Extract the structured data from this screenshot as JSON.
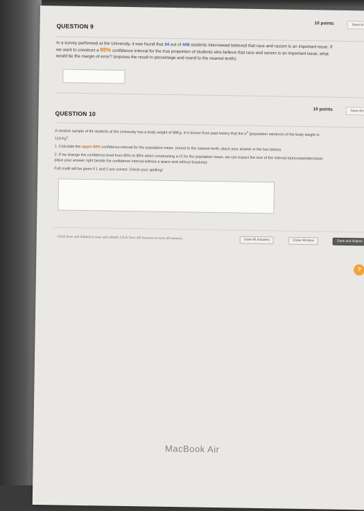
{
  "q9": {
    "title": "QUESTION 9",
    "points": "10 points",
    "save_label": "Save Answer",
    "text_1": "In a survey performed at the University, it was found that ",
    "num_34": "34",
    "text_2": " out of ",
    "num_448": "448",
    "text_3": " students interviewed believed that race and racism is an important issue. If we want to construct a ",
    "pct_95": "95%",
    "text_4": " confidence interval for the true proportion of students who believe that race and racism is an important issue, what would be the margin of error? (express the result in percentage and round to the nearest tenth)."
  },
  "q10": {
    "title": "QUESTION 10",
    "points": "10 points",
    "save_label": "Save Answer",
    "intro_1": "A random sample of 84 students at the University has a body weight of 88Kg. It is known from past history that the σ",
    "intro_sup": "2",
    "intro_2": " (population variance) of the body weight is 110 Kg",
    "intro_sup2": "2",
    "intro_3": ".",
    "item1_prefix": "1. Calculate the ",
    "item1_upper": "upper 80%",
    "item1_suffix": " confidence interval for the population mean. (round to the nearest tenth, place your answer in the box below)",
    "item2": "2. If we change the confidence level from 80% to 95% when constructing a CI for the population mean, we can expect the size of the interval to(increase/decrease; place your answer right beside the confidence interval without a space and without brackets)",
    "full_credit": "Full credit will be given if 1 and 2 are correct. Check your spelling!"
  },
  "footer": {
    "instruction": "Click Save and Submit to save and submit. Click Save All Answers to save all answers.",
    "save_all": "Save All Answers",
    "close_window": "Close Window",
    "save_submit": "Save and Submit",
    "help": "?"
  },
  "device_label": "MacBook Air"
}
